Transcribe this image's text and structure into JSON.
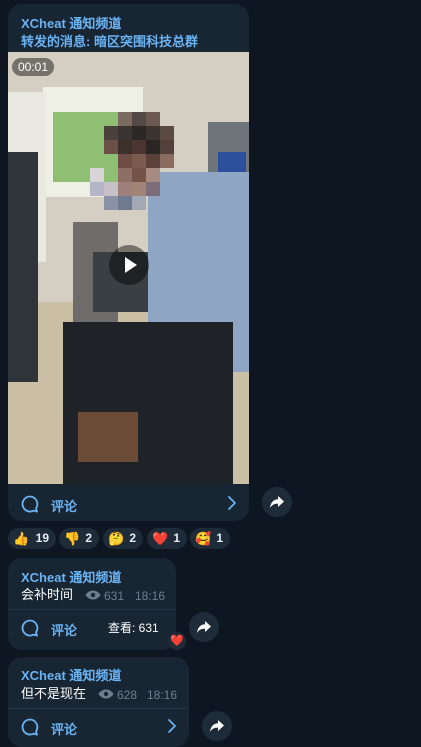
{
  "post1": {
    "channel": "XCheat 通知频道",
    "forwarded": "转发的消息: 暗区突围科技总群",
    "video_duration": "00:01",
    "comment_label": "评论"
  },
  "reactions": [
    {
      "emoji": "👍",
      "count": "19"
    },
    {
      "emoji": "👎",
      "count": "2"
    },
    {
      "emoji": "🤔",
      "count": "2"
    },
    {
      "emoji": "❤️",
      "count": "1"
    },
    {
      "emoji": "🥰",
      "count": "1"
    }
  ],
  "post2": {
    "channel": "XCheat 通知频道",
    "text": "会补时间",
    "views": "631",
    "time": "18:16",
    "comment_label": "评论",
    "tooltip": "查看: 631",
    "reaction_emoji": "❤️"
  },
  "post3": {
    "channel": "XCheat 通知频道",
    "text": "但不是现在",
    "views": "628",
    "time": "18:16",
    "comment_label": "评论"
  },
  "colors": {
    "background": "#0e1621",
    "bubble": "#182533",
    "accent": "#6ab3f3"
  }
}
